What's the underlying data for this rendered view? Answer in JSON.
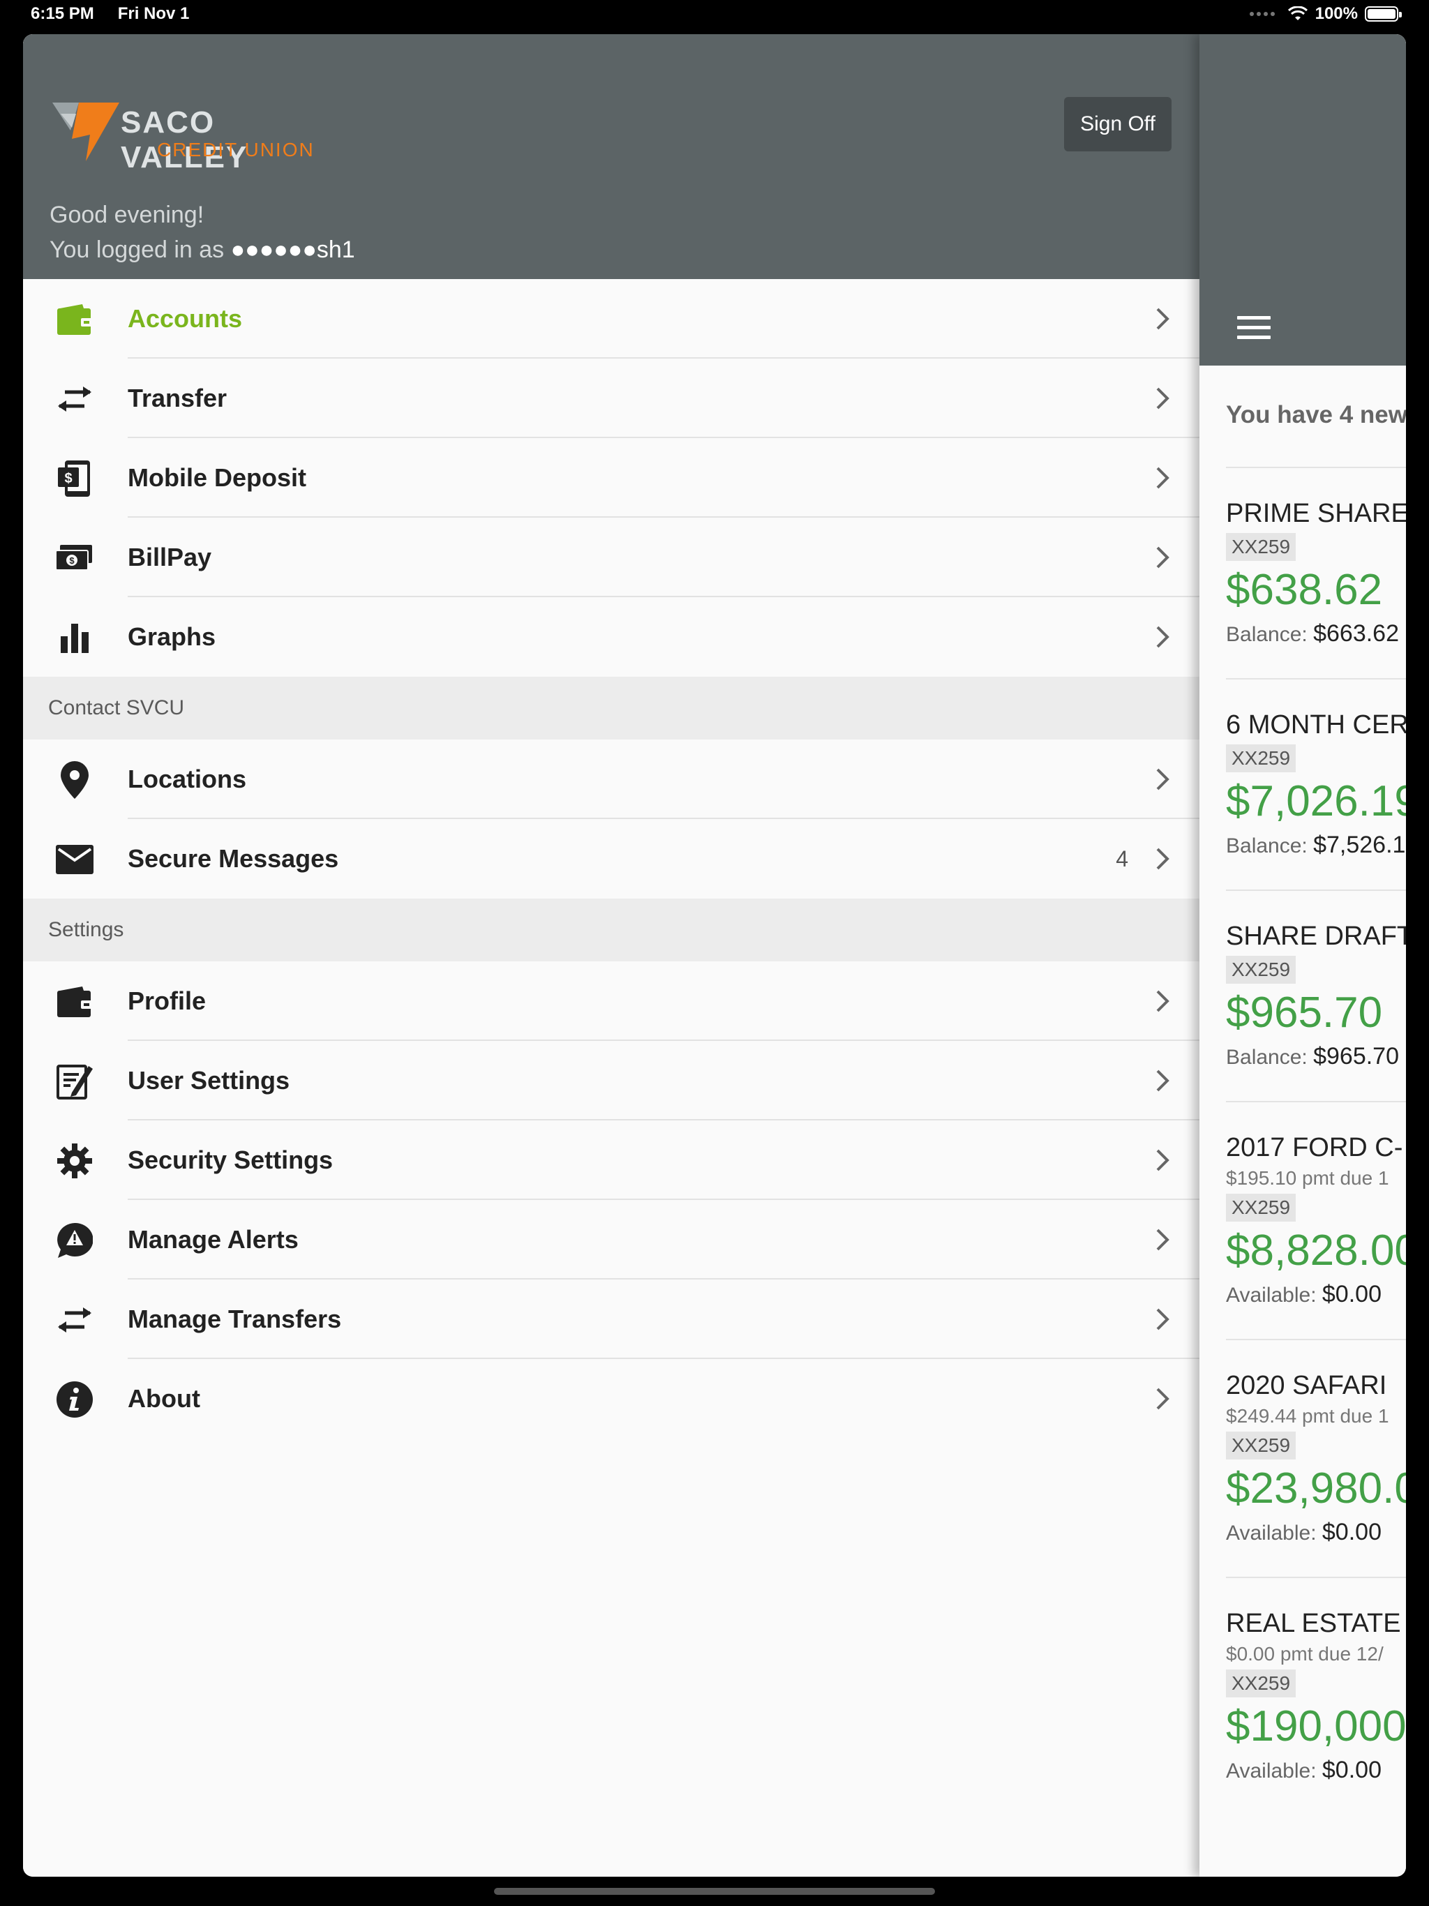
{
  "status_bar": {
    "time": "6:15 PM",
    "date": "Fri Nov 1",
    "battery": "100%",
    "battery_level": 1.0
  },
  "drawer": {
    "logo_title": "SACO VALLEY",
    "logo_subtitle": "CREDIT UNION",
    "sign_off_label": "Sign Off",
    "greeting": "Good evening!",
    "logged_in_prefix": "You logged in as ",
    "username": "●●●●●●sh1",
    "menu_main": [
      {
        "label": "Accounts",
        "icon": "wallet-icon"
      },
      {
        "label": "Transfer",
        "icon": "transfer-arrows-icon"
      },
      {
        "label": "Mobile Deposit",
        "icon": "mobile-deposit-icon"
      },
      {
        "label": "BillPay",
        "icon": "cash-icon"
      },
      {
        "label": "Graphs",
        "icon": "bar-chart-icon"
      }
    ],
    "section_contact": "Contact SVCU",
    "menu_contact": [
      {
        "label": "Locations",
        "icon": "location-pin-icon"
      },
      {
        "label": "Secure Messages",
        "icon": "envelope-icon",
        "count": "4"
      }
    ],
    "section_settings": "Settings",
    "menu_settings": [
      {
        "label": "Profile",
        "icon": "wallet-icon"
      },
      {
        "label": "User Settings",
        "icon": "edit-document-icon"
      },
      {
        "label": "Security Settings",
        "icon": "gear-icon"
      },
      {
        "label": "Manage Alerts",
        "icon": "alert-bubble-icon"
      },
      {
        "label": "Manage Transfers",
        "icon": "transfer-arrows-icon"
      },
      {
        "label": "About",
        "icon": "info-icon"
      }
    ],
    "colors": {
      "header": "#5c6466",
      "active": "#7ab51d",
      "logo_orange": "#f07d1a"
    }
  },
  "content": {
    "new_messages": "You have 4 new",
    "accounts": [
      {
        "name": "PRIME SHARE",
        "sub": "",
        "tag": "XX259",
        "amount": "$638.62",
        "bal_label": "Balance:",
        "bal_value": "$663.62"
      },
      {
        "name": "6 MONTH CER",
        "sub": "",
        "tag": "XX259",
        "amount": "$7,026.19",
        "bal_label": "Balance:",
        "bal_value": "$7,526.1"
      },
      {
        "name": "SHARE DRAFT",
        "sub": "",
        "tag": "XX259",
        "amount": "$965.70",
        "bal_label": "Balance:",
        "bal_value": "$965.70"
      },
      {
        "name": "2017 FORD C-",
        "sub": "$195.10 pmt due 1",
        "tag": "XX259",
        "amount": "$8,828.00",
        "bal_label": "Available:",
        "bal_value": "$0.00"
      },
      {
        "name": "2020 SAFARI",
        "sub": "$249.44 pmt due 1",
        "tag": "XX259",
        "amount": "$23,980.0",
        "bal_label": "Available:",
        "bal_value": "$0.00"
      },
      {
        "name": "REAL ESTATE",
        "sub": "$0.00 pmt due 12/",
        "tag": "XX259",
        "amount": "$190,000",
        "bal_label": "Available:",
        "bal_value": "$0.00"
      }
    ],
    "colors": {
      "amount": "#43a047"
    }
  }
}
